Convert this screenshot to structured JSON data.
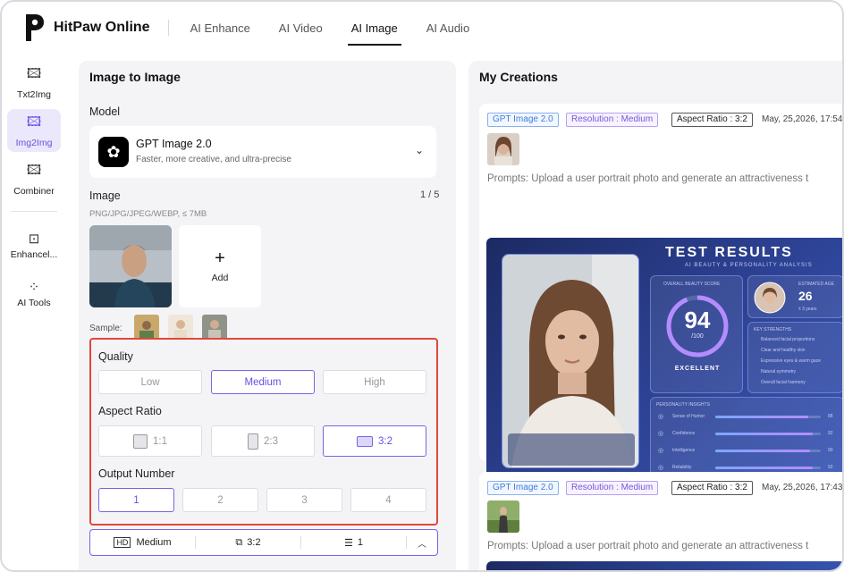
{
  "header": {
    "brand": "HitPaw Online",
    "nav": [
      {
        "label": "AI Enhance"
      },
      {
        "label": "AI Video"
      },
      {
        "label": "AI Image"
      },
      {
        "label": "AI Audio"
      }
    ]
  },
  "sidebar": {
    "items": [
      {
        "label": "Txt2Img"
      },
      {
        "label": "Img2Img"
      },
      {
        "label": "Combiner"
      },
      {
        "label": "Enhancel..."
      },
      {
        "label": "AI Tools"
      }
    ]
  },
  "left": {
    "title": "Image to Image",
    "model_label": "Model",
    "model_name": "GPT Image 2.0",
    "model_desc": "Faster, more creative, and ultra-precise",
    "image_label": "Image",
    "image_count": "1 / 5",
    "image_formats": "PNG/JPG/JPEG/WEBP, ≤ 7MB",
    "add_label": "Add",
    "sample_label": "Sample:",
    "quality_label": "Quality",
    "quality_options": [
      "Low",
      "Medium",
      "High"
    ],
    "aspect_label": "Aspect Ratio",
    "aspect_options": [
      "1:1",
      "2:3",
      "3:2"
    ],
    "output_label": "Output Number",
    "output_options": [
      "1",
      "2",
      "3",
      "4"
    ],
    "summary": {
      "quality": "Medium",
      "ratio": "3:2",
      "count": "1"
    }
  },
  "right": {
    "title": "My Creations",
    "cards": [
      {
        "model_tag": "GPT Image 2.0",
        "resolution_tag": "Resolution : Medium",
        "ratio_tag": "Aspect Ratio : 3:2",
        "date": "May, 25,2026, 17:54",
        "prompt": "Prompts: Upload a user portrait photo and generate an attractiveness t"
      },
      {
        "model_tag": "GPT Image 2.0",
        "resolution_tag": "Resolution : Medium",
        "ratio_tag": "Aspect Ratio : 3:2",
        "date": "May, 25,2026, 17:43",
        "prompt": "Prompts: Upload a user portrait photo and generate an attractiveness t"
      }
    ],
    "result": {
      "title": "TEST RESULTS",
      "subtitle": "AI BEAUTY & PERSONALITY ANALYSIS",
      "score_label": "OVERALL BEAUTY SCORE",
      "score": "94",
      "score_max": "/100",
      "score_grade": "EXCELLENT",
      "age_label": "ESTIMATED AGE",
      "age": "26",
      "age_range": "± 3 years",
      "strengths_label": "KEY STRENGTHS",
      "strengths": [
        "Balanced facial proportions",
        "Clear and healthy skin",
        "Expressive eyes & warm gaze",
        "Natural symmetry",
        "Overall facial harmony"
      ],
      "insights_label": "PERSONALITY INSIGHTS",
      "insights": [
        {
          "name": "Sense of Humor",
          "value": 88
        },
        {
          "name": "Confidence",
          "value": 92
        },
        {
          "name": "Intelligence",
          "value": 90
        },
        {
          "name": "Reliability",
          "value": 92
        }
      ]
    }
  }
}
